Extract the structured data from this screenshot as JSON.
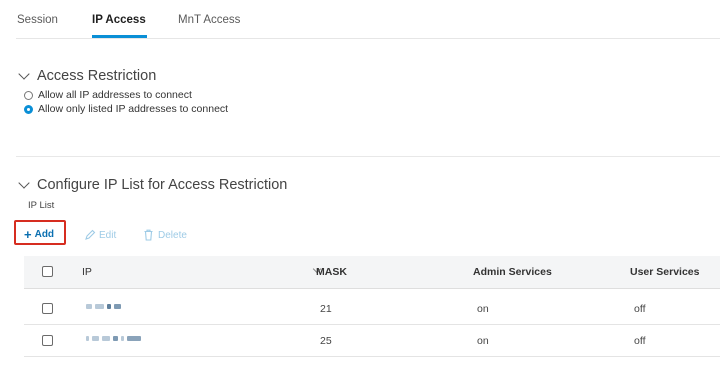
{
  "tabs": [
    {
      "label": "Session",
      "active": false
    },
    {
      "label": "IP Access",
      "active": true
    },
    {
      "label": "MnT Access",
      "active": false
    }
  ],
  "access_restriction": {
    "title": "Access Restriction",
    "options": [
      {
        "label": "Allow all IP addresses to connect",
        "selected": false
      },
      {
        "label": "Allow only listed IP addresses to connect",
        "selected": true
      }
    ]
  },
  "ip_list_section": {
    "title": "Configure IP List for Access Restriction",
    "list_label": "IP List",
    "toolbar": {
      "add": "Add",
      "edit": "Edit",
      "delete": "Delete"
    },
    "columns": [
      "IP",
      "MASK",
      "Admin Services",
      "User Services"
    ],
    "rows": [
      {
        "ip": "",
        "mask": "21",
        "admin": "on",
        "user": "off"
      },
      {
        "ip": "",
        "mask": "25",
        "admin": "on",
        "user": "off"
      }
    ]
  },
  "colors": {
    "accent": "#0a8fd6",
    "highlight_border": "#d62d20"
  }
}
